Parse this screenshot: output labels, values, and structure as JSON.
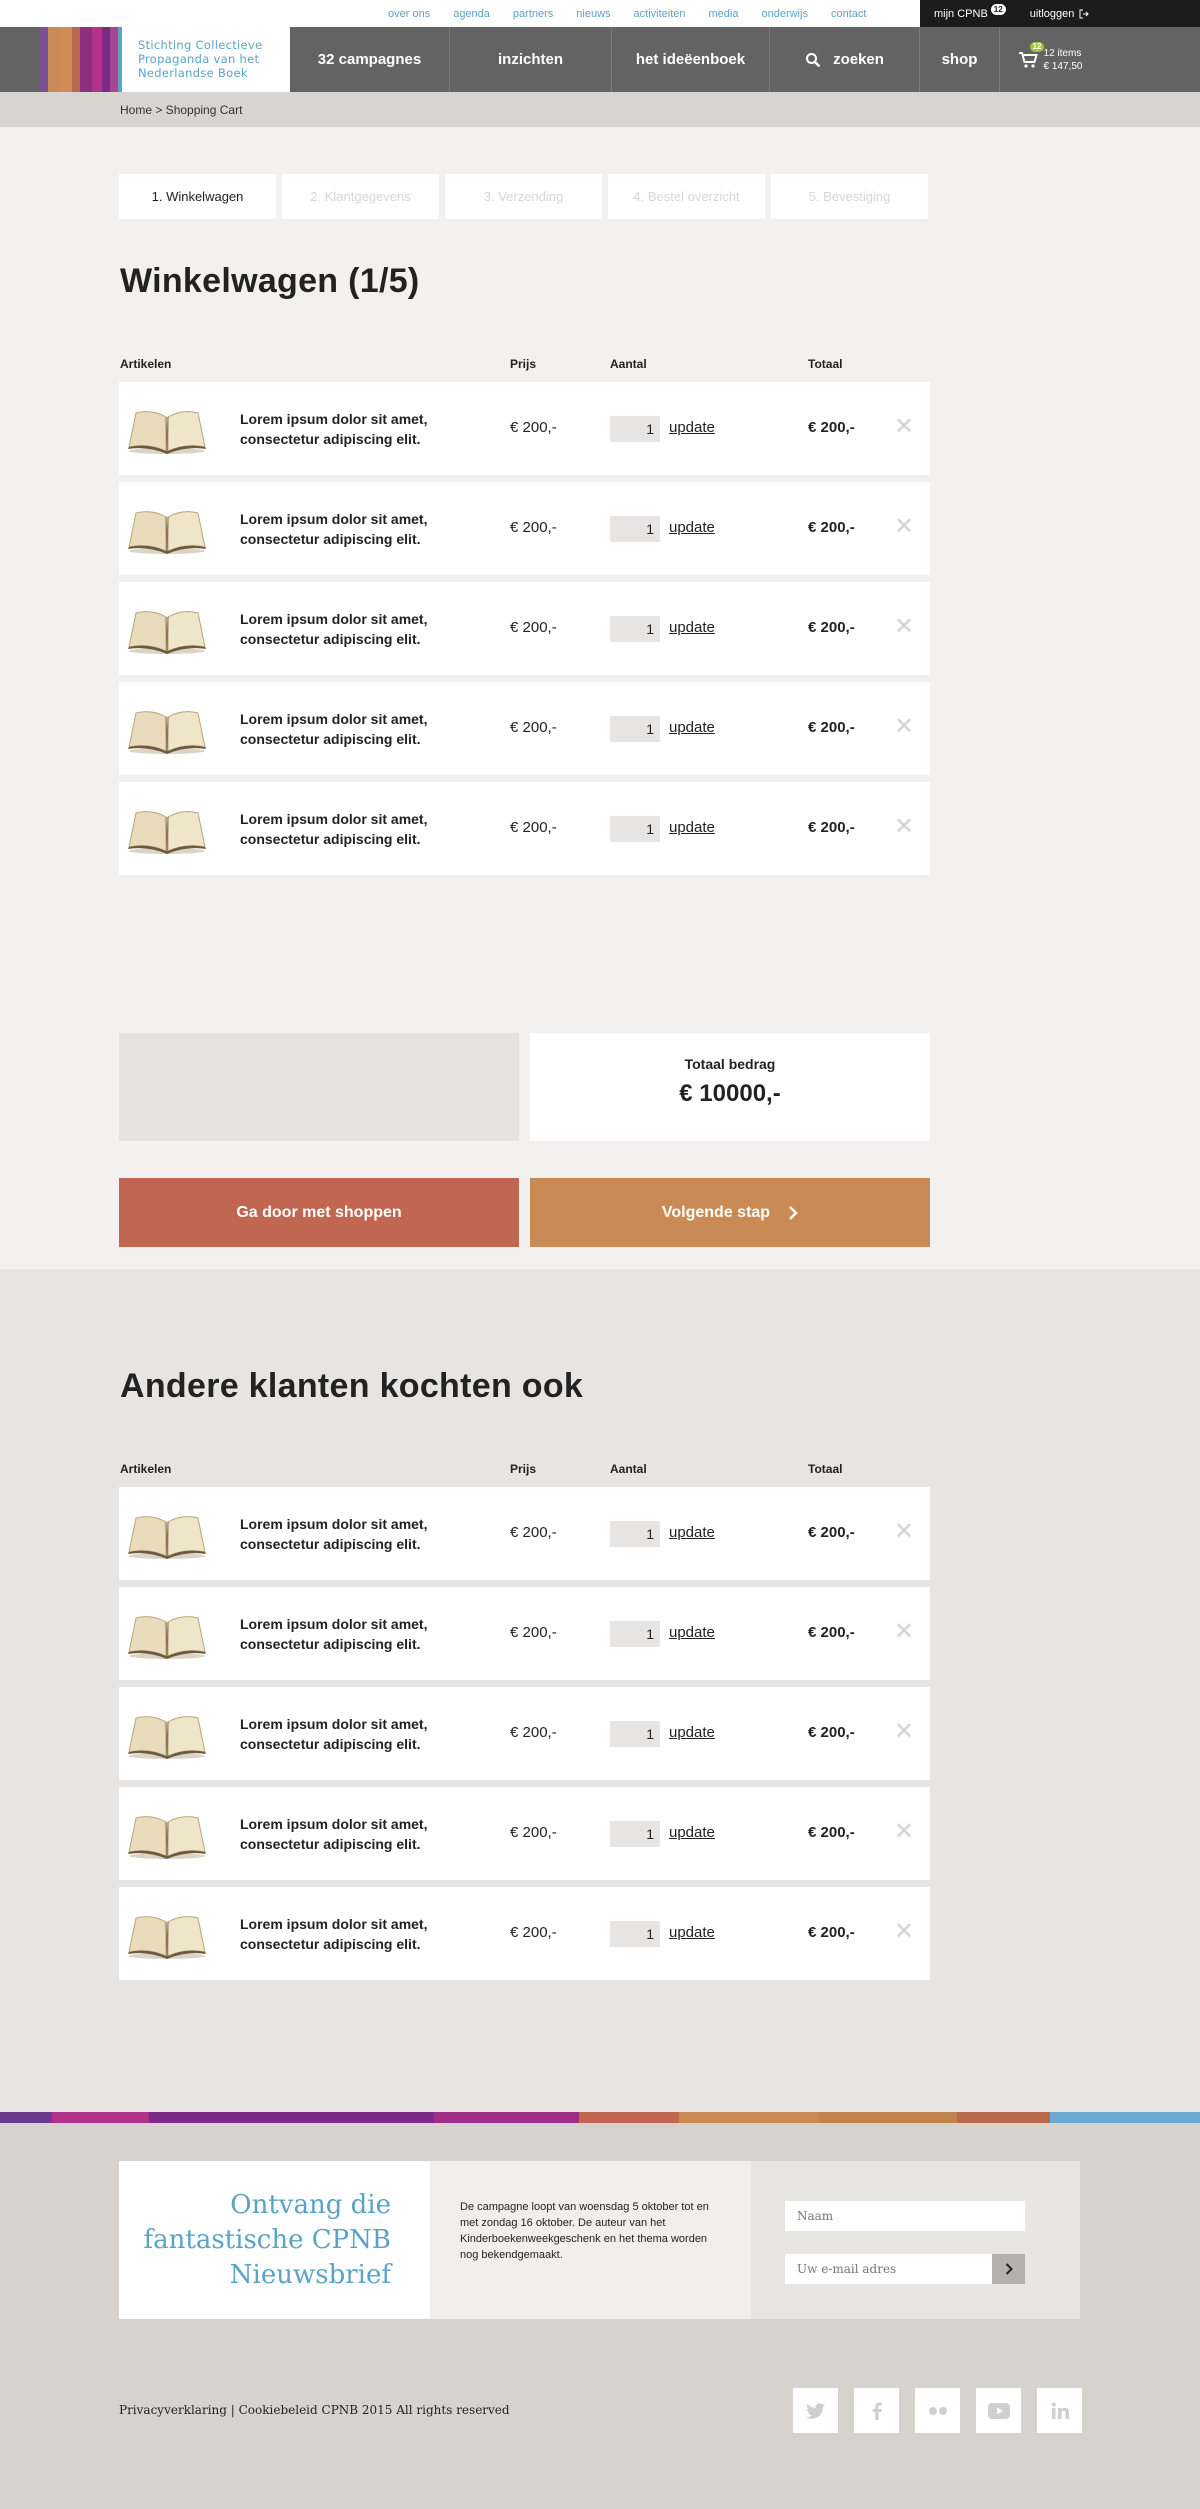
{
  "topbar": {
    "links": [
      "over ons",
      "agenda",
      "partners",
      "nieuws",
      "activiteiten",
      "media",
      "onderwijs",
      "contact"
    ],
    "mijn_label": "mijn CPNB",
    "mijn_badge": "12",
    "logout_label": "uitloggen"
  },
  "logo": {
    "lines": [
      "Stichting Collectieve",
      "Propaganda van het",
      "Nederlandse Boek"
    ]
  },
  "nav": {
    "campaigns": "32 campagnes",
    "insights": "inzichten",
    "ideas": "het ideëenboek",
    "search": "zoeken",
    "shop": "shop",
    "cart_badge": "12",
    "cart_items": "12 items",
    "cart_total": "€ 147,50"
  },
  "breadcrumb": "Home > Shopping Cart",
  "steps": [
    "1. Winkelwagen",
    "2. Klantgegevens",
    "3. Verzending",
    "4. Bestel overzicht",
    "5. Bevestiging"
  ],
  "cart": {
    "title": "Winkelwagen (1/5)",
    "headers": {
      "items": "Artikelen",
      "price": "Prijs",
      "qty": "Aantal",
      "total": "Totaal"
    },
    "rows": [
      {
        "title1": "Lorem ipsum dolor sit amet,",
        "title2": "consectetur adipiscing elit.",
        "price": "€ 200,-",
        "qty": "1",
        "update": "update",
        "total": "€ 200,-",
        "remove": "✕"
      },
      {
        "title1": "Lorem ipsum dolor sit amet,",
        "title2": "consectetur adipiscing elit.",
        "price": "€ 200,-",
        "qty": "1",
        "update": "update",
        "total": "€ 200,-",
        "remove": "✕"
      },
      {
        "title1": "Lorem ipsum dolor sit amet,",
        "title2": "consectetur adipiscing elit.",
        "price": "€ 200,-",
        "qty": "1",
        "update": "update",
        "total": "€ 200,-",
        "remove": "✕"
      },
      {
        "title1": "Lorem ipsum dolor sit amet,",
        "title2": "consectetur adipiscing elit.",
        "price": "€ 200,-",
        "qty": "1",
        "update": "update",
        "total": "€ 200,-",
        "remove": "✕"
      },
      {
        "title1": "Lorem ipsum dolor sit amet,",
        "title2": "consectetur adipiscing elit.",
        "price": "€ 200,-",
        "qty": "1",
        "update": "update",
        "total": "€ 200,-",
        "remove": "✕"
      }
    ],
    "total_label": "Totaal bedrag",
    "total_value": "€ 10000,-",
    "continue_label": "Ga door met shoppen",
    "next_label": "Volgende stap"
  },
  "others": {
    "title": "Andere klanten kochten ook",
    "headers": {
      "items": "Artikelen",
      "price": "Prijs",
      "qty": "Aantal",
      "total": "Totaal"
    },
    "rows": [
      {
        "title1": "Lorem ipsum dolor sit amet,",
        "title2": "consectetur adipiscing elit.",
        "price": "€ 200,-",
        "qty": "1",
        "update": "update",
        "total": "€ 200,-",
        "remove": "✕"
      },
      {
        "title1": "Lorem ipsum dolor sit amet,",
        "title2": "consectetur adipiscing elit.",
        "price": "€ 200,-",
        "qty": "1",
        "update": "update",
        "total": "€ 200,-",
        "remove": "✕"
      },
      {
        "title1": "Lorem ipsum dolor sit amet,",
        "title2": "consectetur adipiscing elit.",
        "price": "€ 200,-",
        "qty": "1",
        "update": "update",
        "total": "€ 200,-",
        "remove": "✕"
      },
      {
        "title1": "Lorem ipsum dolor sit amet,",
        "title2": "consectetur adipiscing elit.",
        "price": "€ 200,-",
        "qty": "1",
        "update": "update",
        "total": "€ 200,-",
        "remove": "✕"
      },
      {
        "title1": "Lorem ipsum dolor sit amet,",
        "title2": "consectetur adipiscing elit.",
        "price": "€ 200,-",
        "qty": "1",
        "update": "update",
        "total": "€ 200,-",
        "remove": "✕"
      }
    ]
  },
  "footer": {
    "newsletter_lines": [
      "Ontvang die",
      "fantastische CPNB",
      "Nieuwsbrief"
    ],
    "description": "De campagne loopt van woensdag 5 oktober tot en met zondag 16 oktober. De auteur van het Kinderboekenweekgeschenk en het thema worden nog bekendgemaakt.",
    "name_placeholder": "Naam",
    "email_placeholder": "Uw e-mail adres",
    "legal": "Privacyverklaring | Cookiebeleid  CPNB 2015 All rights reserved",
    "socials": [
      "twitter-icon",
      "facebook-icon",
      "flickr-icon",
      "youtube-icon",
      "linkedin-icon"
    ]
  },
  "colors": {
    "accent_blue": "#5aa3c8",
    "continue_button": "#c06651",
    "next_button": "#c98a55",
    "nav_bg": "#636363"
  }
}
